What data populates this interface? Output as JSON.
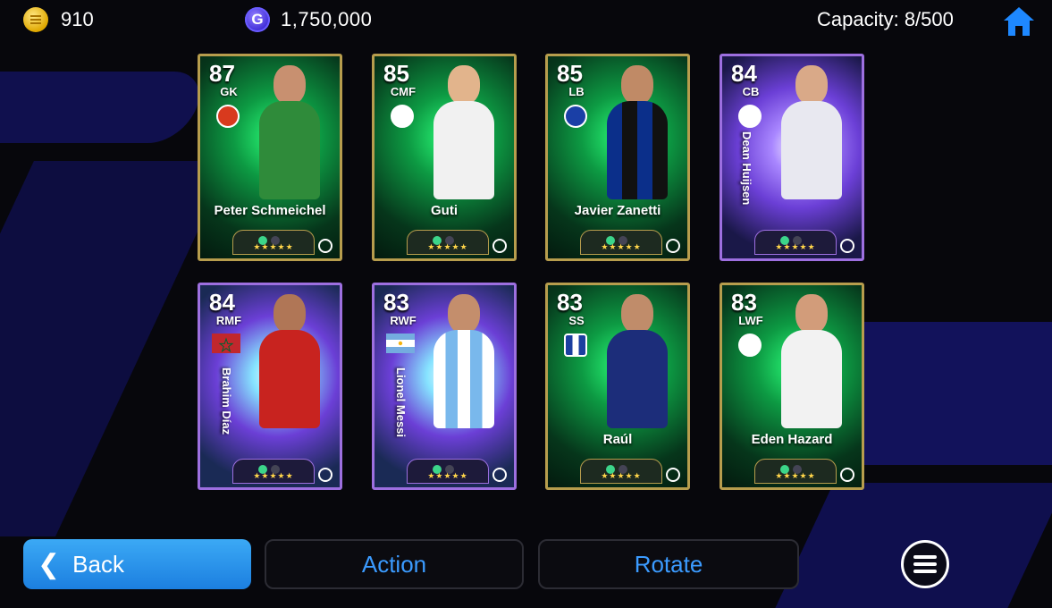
{
  "currency": {
    "coins": "910",
    "gp": "1,750,000",
    "gp_symbol": "G"
  },
  "capacity_label": "Capacity: 8/500",
  "cards": [
    {
      "rating": "87",
      "position": "GK",
      "name": "Peter Schmeichel",
      "stars": "★★★★★",
      "style": "green"
    },
    {
      "rating": "85",
      "position": "CMF",
      "name": "Guti",
      "stars": "★★★★★",
      "style": "green"
    },
    {
      "rating": "85",
      "position": "LB",
      "name": "Javier Zanetti",
      "stars": "★★★★★",
      "style": "green"
    },
    {
      "rating": "84",
      "position": "CB",
      "name": "Dean Huijsen",
      "stars": "★★★★★",
      "style": "purple"
    },
    {
      "rating": "84",
      "position": "RMF",
      "name": "Brahim Díaz",
      "stars": "★★★★★",
      "style": "purple"
    },
    {
      "rating": "83",
      "position": "RWF",
      "name": "Lionel Messi",
      "stars": "★★★★★",
      "style": "purple"
    },
    {
      "rating": "83",
      "position": "SS",
      "name": "Raúl",
      "stars": "★★★★★",
      "style": "green"
    },
    {
      "rating": "83",
      "position": "LWF",
      "name": "Eden Hazard",
      "stars": "★★★★★",
      "style": "green"
    }
  ],
  "buttons": {
    "back": "Back",
    "action": "Action",
    "rotate": "Rotate"
  },
  "colors": {
    "accent_blue": "#3b9bff",
    "back_button": "#1c7fe0",
    "gold_frame": "#b79d4d",
    "purple_frame": "#9d6fe0"
  },
  "icons": {
    "coin": "coin-icon",
    "gp": "gp-icon",
    "home": "home-icon",
    "menu": "list-menu-icon",
    "back": "chevron-left-icon"
  }
}
